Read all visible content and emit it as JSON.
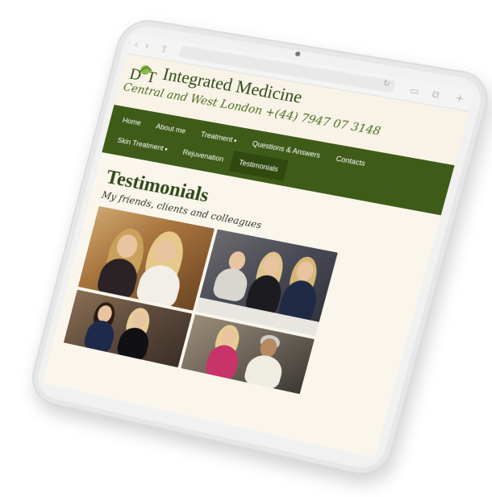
{
  "site": {
    "title": "Integrated Medicine",
    "subtitle": "Central and West London +(44) 7947 07 3148"
  },
  "nav": {
    "row1": [
      {
        "label": "Home",
        "caret": ""
      },
      {
        "label": "About me",
        "caret": ""
      },
      {
        "label": "Treatment",
        "caret": "▾"
      },
      {
        "label": "Questions & Answers",
        "caret": ""
      },
      {
        "label": "Contacts",
        "caret": ""
      }
    ],
    "row2": [
      {
        "label": "Skin Treatment",
        "caret": "▾"
      },
      {
        "label": "Rejuvenation",
        "caret": ""
      },
      {
        "label": "Testimonials",
        "caret": ""
      }
    ],
    "active": "Testimonials"
  },
  "page": {
    "title": "Testimonials",
    "subtitle": "My friends, clients and colleagues"
  },
  "colors": {
    "nav_bg": "#3e5b18",
    "title_green": "#2f4a18",
    "page_bg": "#faf6ec"
  }
}
